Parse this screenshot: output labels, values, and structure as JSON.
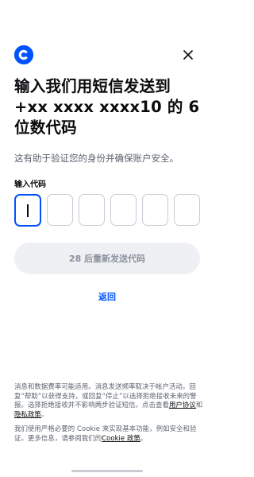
{
  "brand": {
    "logo_icon": "coinbase-logo-icon",
    "accent_color": "#0052ff"
  },
  "header": {
    "close_icon": "close-icon"
  },
  "title": "输入我们用短信发送到 +xx xxxx xxxx10 的 6 位数代码",
  "subtitle": "这有助于验证您的身份并确保账户安全。",
  "code": {
    "label": "输入代码",
    "length": 6,
    "values": [
      "",
      "",
      "",
      "",
      "",
      ""
    ]
  },
  "resend_button": "28 后重新发送代码",
  "back_link": "返回",
  "fine_print": {
    "p1_text": "消息和数据费率可能适用。消息发送频率取决于帐户活动。回复“帮助”以获得支持，或回复“停止”以选择拒绝接收未来的警报。选择拒绝接收并不影响两步验证短信。点击查看",
    "p1_link1": "用户协议",
    "p1_and": "和",
    "p1_link2": "隐私政策",
    "p1_end": "。",
    "p2_text": "我们使用严格必要的 Cookie 来实现基本功能，例如安全和验证。更多信息，请参阅我们的",
    "p2_link": "Cookie 政策",
    "p2_end": "。"
  }
}
